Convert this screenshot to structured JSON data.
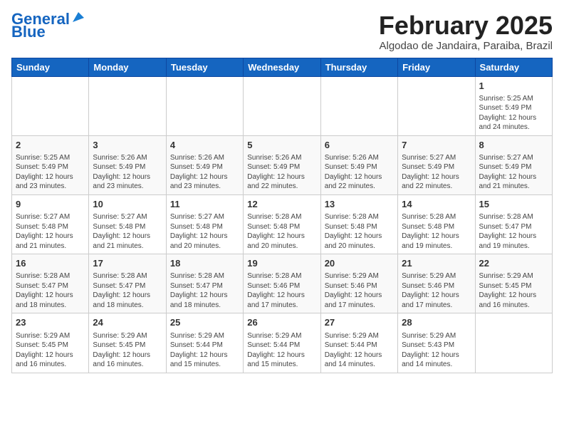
{
  "logo": {
    "line1": "General",
    "line2": "Blue"
  },
  "title": "February 2025",
  "subtitle": "Algodao de Jandaira, Paraiba, Brazil",
  "headers": [
    "Sunday",
    "Monday",
    "Tuesday",
    "Wednesday",
    "Thursday",
    "Friday",
    "Saturday"
  ],
  "weeks": [
    [
      {
        "day": "",
        "info": ""
      },
      {
        "day": "",
        "info": ""
      },
      {
        "day": "",
        "info": ""
      },
      {
        "day": "",
        "info": ""
      },
      {
        "day": "",
        "info": ""
      },
      {
        "day": "",
        "info": ""
      },
      {
        "day": "1",
        "info": "Sunrise: 5:25 AM\nSunset: 5:49 PM\nDaylight: 12 hours\nand 24 minutes."
      }
    ],
    [
      {
        "day": "2",
        "info": "Sunrise: 5:25 AM\nSunset: 5:49 PM\nDaylight: 12 hours\nand 23 minutes."
      },
      {
        "day": "3",
        "info": "Sunrise: 5:26 AM\nSunset: 5:49 PM\nDaylight: 12 hours\nand 23 minutes."
      },
      {
        "day": "4",
        "info": "Sunrise: 5:26 AM\nSunset: 5:49 PM\nDaylight: 12 hours\nand 23 minutes."
      },
      {
        "day": "5",
        "info": "Sunrise: 5:26 AM\nSunset: 5:49 PM\nDaylight: 12 hours\nand 22 minutes."
      },
      {
        "day": "6",
        "info": "Sunrise: 5:26 AM\nSunset: 5:49 PM\nDaylight: 12 hours\nand 22 minutes."
      },
      {
        "day": "7",
        "info": "Sunrise: 5:27 AM\nSunset: 5:49 PM\nDaylight: 12 hours\nand 22 minutes."
      },
      {
        "day": "8",
        "info": "Sunrise: 5:27 AM\nSunset: 5:49 PM\nDaylight: 12 hours\nand 21 minutes."
      }
    ],
    [
      {
        "day": "9",
        "info": "Sunrise: 5:27 AM\nSunset: 5:48 PM\nDaylight: 12 hours\nand 21 minutes."
      },
      {
        "day": "10",
        "info": "Sunrise: 5:27 AM\nSunset: 5:48 PM\nDaylight: 12 hours\nand 21 minutes."
      },
      {
        "day": "11",
        "info": "Sunrise: 5:27 AM\nSunset: 5:48 PM\nDaylight: 12 hours\nand 20 minutes."
      },
      {
        "day": "12",
        "info": "Sunrise: 5:28 AM\nSunset: 5:48 PM\nDaylight: 12 hours\nand 20 minutes."
      },
      {
        "day": "13",
        "info": "Sunrise: 5:28 AM\nSunset: 5:48 PM\nDaylight: 12 hours\nand 20 minutes."
      },
      {
        "day": "14",
        "info": "Sunrise: 5:28 AM\nSunset: 5:48 PM\nDaylight: 12 hours\nand 19 minutes."
      },
      {
        "day": "15",
        "info": "Sunrise: 5:28 AM\nSunset: 5:47 PM\nDaylight: 12 hours\nand 19 minutes."
      }
    ],
    [
      {
        "day": "16",
        "info": "Sunrise: 5:28 AM\nSunset: 5:47 PM\nDaylight: 12 hours\nand 18 minutes."
      },
      {
        "day": "17",
        "info": "Sunrise: 5:28 AM\nSunset: 5:47 PM\nDaylight: 12 hours\nand 18 minutes."
      },
      {
        "day": "18",
        "info": "Sunrise: 5:28 AM\nSunset: 5:47 PM\nDaylight: 12 hours\nand 18 minutes."
      },
      {
        "day": "19",
        "info": "Sunrise: 5:28 AM\nSunset: 5:46 PM\nDaylight: 12 hours\nand 17 minutes."
      },
      {
        "day": "20",
        "info": "Sunrise: 5:29 AM\nSunset: 5:46 PM\nDaylight: 12 hours\nand 17 minutes."
      },
      {
        "day": "21",
        "info": "Sunrise: 5:29 AM\nSunset: 5:46 PM\nDaylight: 12 hours\nand 17 minutes."
      },
      {
        "day": "22",
        "info": "Sunrise: 5:29 AM\nSunset: 5:45 PM\nDaylight: 12 hours\nand 16 minutes."
      }
    ],
    [
      {
        "day": "23",
        "info": "Sunrise: 5:29 AM\nSunset: 5:45 PM\nDaylight: 12 hours\nand 16 minutes."
      },
      {
        "day": "24",
        "info": "Sunrise: 5:29 AM\nSunset: 5:45 PM\nDaylight: 12 hours\nand 16 minutes."
      },
      {
        "day": "25",
        "info": "Sunrise: 5:29 AM\nSunset: 5:44 PM\nDaylight: 12 hours\nand 15 minutes."
      },
      {
        "day": "26",
        "info": "Sunrise: 5:29 AM\nSunset: 5:44 PM\nDaylight: 12 hours\nand 15 minutes."
      },
      {
        "day": "27",
        "info": "Sunrise: 5:29 AM\nSunset: 5:44 PM\nDaylight: 12 hours\nand 14 minutes."
      },
      {
        "day": "28",
        "info": "Sunrise: 5:29 AM\nSunset: 5:43 PM\nDaylight: 12 hours\nand 14 minutes."
      },
      {
        "day": "",
        "info": ""
      }
    ]
  ]
}
